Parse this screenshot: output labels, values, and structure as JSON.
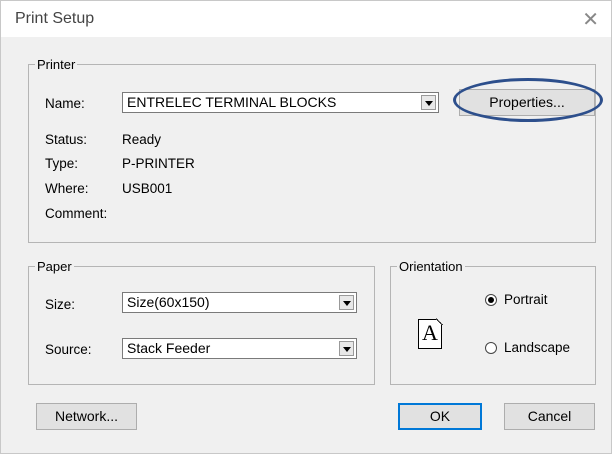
{
  "window": {
    "title": "Print Setup",
    "close_glyph": "✕"
  },
  "printer": {
    "legend": "Printer",
    "name_label": "Name:",
    "name_value": "ENTRELEC TERMINAL BLOCKS",
    "properties_button": "Properties...",
    "status_label": "Status:",
    "status_value": "Ready",
    "type_label": "Type:",
    "type_value": "P-PRINTER",
    "where_label": "Where:",
    "where_value": "USB001",
    "comment_label": "Comment:",
    "comment_value": ""
  },
  "paper": {
    "legend": "Paper",
    "size_label": "Size:",
    "size_value": "Size(60x150)",
    "source_label": "Source:",
    "source_value": "Stack Feeder"
  },
  "orientation": {
    "legend": "Orientation",
    "icon_letter": "A",
    "portrait_label": "Portrait",
    "landscape_label": "Landscape",
    "selected": "Portrait"
  },
  "buttons": {
    "network": "Network...",
    "ok": "OK",
    "cancel": "Cancel"
  },
  "colors": {
    "annotation": "#2d4f8c",
    "accent": "#0078d7"
  },
  "icons": {
    "close": "close-icon",
    "dropdown": "chevron-down-icon",
    "orientation": "portrait-page-icon"
  }
}
